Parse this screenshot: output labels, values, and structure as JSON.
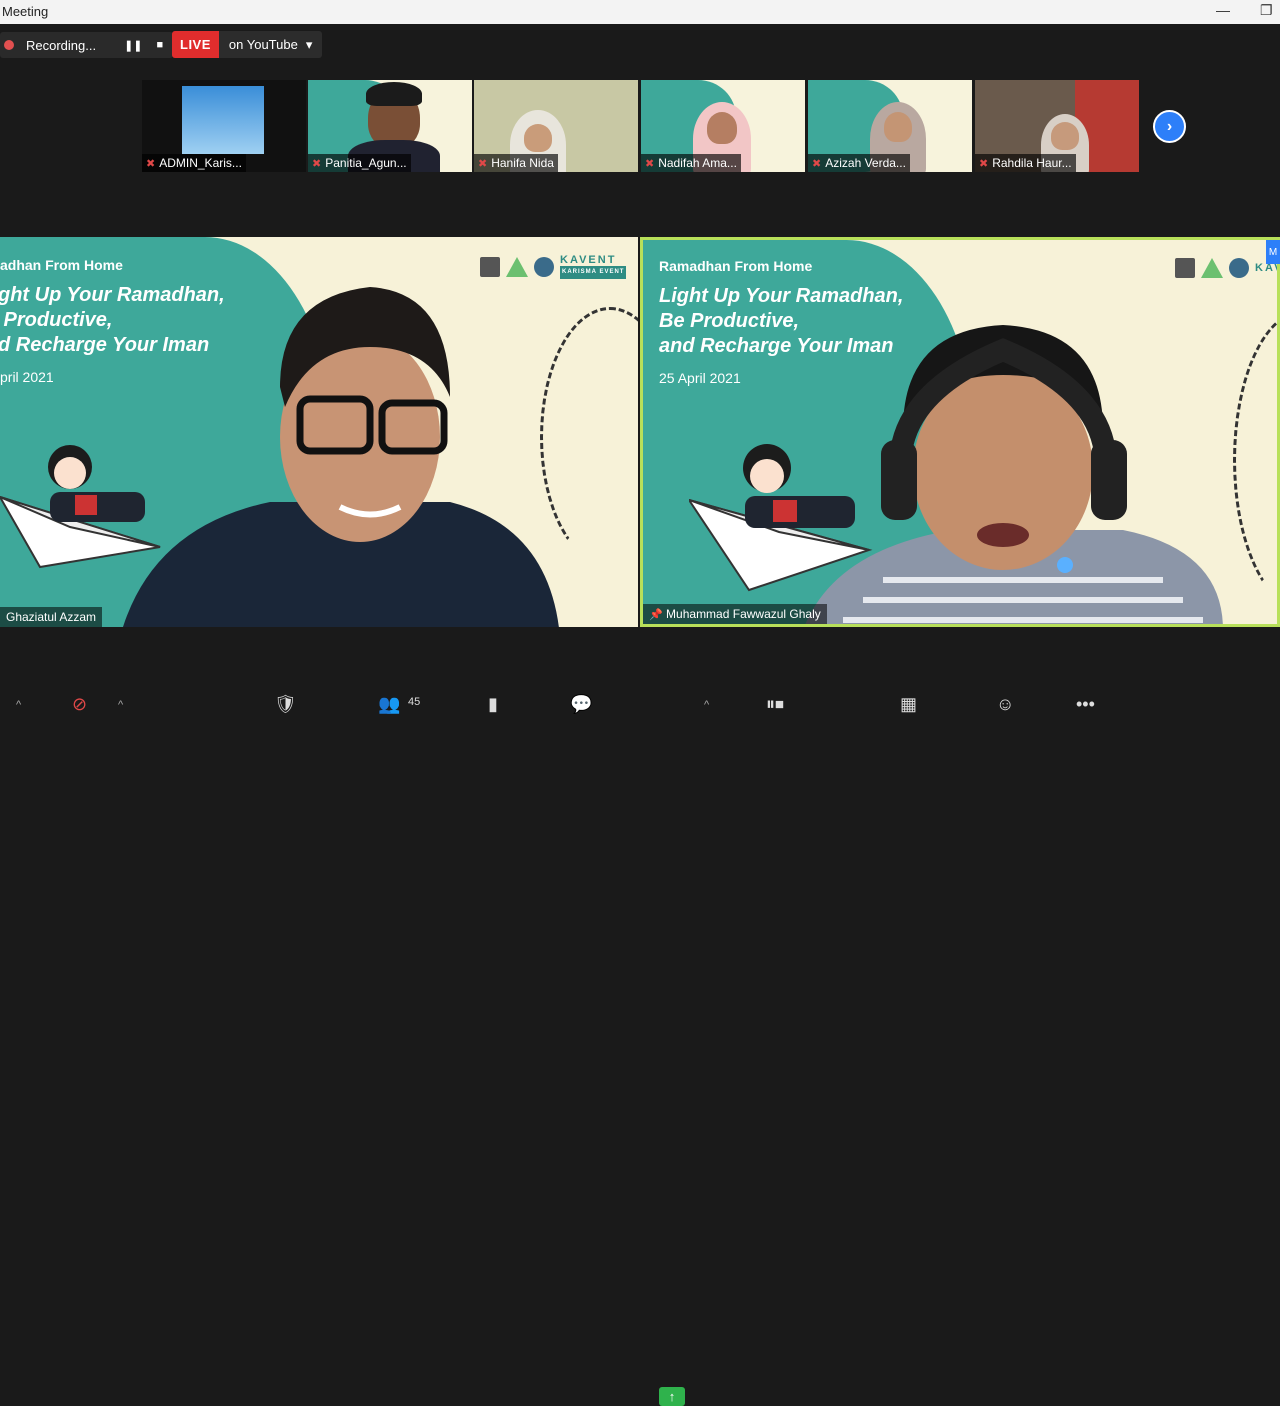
{
  "window": {
    "title": "Meeting",
    "minimize": "—",
    "restore": "❐"
  },
  "recording": {
    "label": "Recording...",
    "pause": "❚❚",
    "stop": "■"
  },
  "live": {
    "badge": "LIVE",
    "destination": "on YouTube",
    "caret": "▾"
  },
  "participants_strip": [
    {
      "name": "ADMIN_Karis..."
    },
    {
      "name": "Panitia_Agun..."
    },
    {
      "name": "Hanifa Nida"
    },
    {
      "name": "Nadifah Ama..."
    },
    {
      "name": "Azizah Verda..."
    },
    {
      "name": "Rahdila Haur..."
    }
  ],
  "next_page": "›",
  "slide": {
    "subtitle_left": "adhan From Home",
    "title_left": "ght Up Your Ramadhan,\n Productive,\nd Recharge Your Iman",
    "date_left": "pril 2021",
    "subtitle_right": "Ramadhan From Home",
    "title_right": "Light Up Your Ramadhan,\nBe Productive,\nand Recharge Your Iman",
    "date_right": "25 April 2021",
    "brand": "KAVENT",
    "brand_sub": "KARISMA EVENT"
  },
  "main_tiles": [
    {
      "name": "Ghaziatul Azzam"
    },
    {
      "name": "Muhammad Fawwazul Ghaly"
    }
  ],
  "corner_badge": "M",
  "toolbar": {
    "participants_count": "45",
    "caret": "^"
  },
  "colors": {
    "teal": "#3ea89a",
    "cream": "#f7f2d8",
    "live": "#e02d2d",
    "active_border": "#b8e05a",
    "share": "#2fb24c",
    "accent": "#2d7ff9"
  }
}
